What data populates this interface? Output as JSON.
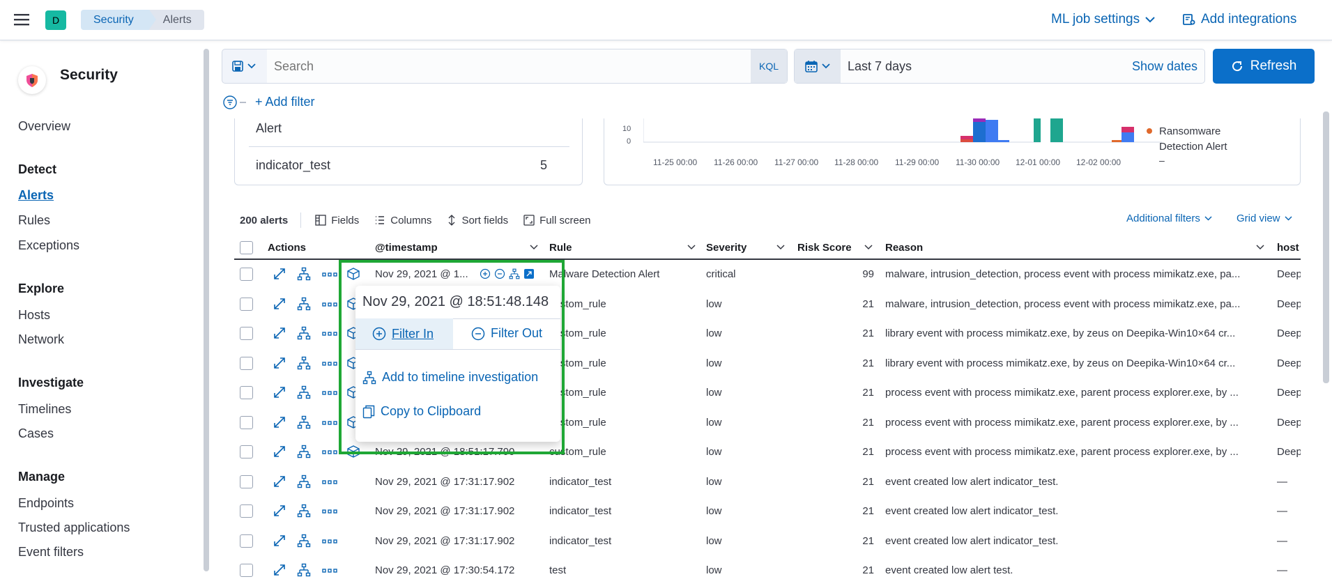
{
  "header": {
    "space_initial": "D",
    "breadcrumbs": [
      "Security",
      "Alerts"
    ],
    "ml_job_settings": "ML job settings",
    "add_integrations": "Add integrations"
  },
  "sidebar": {
    "title": "Security",
    "overview": "Overview",
    "sections": [
      {
        "heading": "Detect",
        "items": [
          "Alerts",
          "Rules",
          "Exceptions"
        ]
      },
      {
        "heading": "Explore",
        "items": [
          "Hosts",
          "Network"
        ]
      },
      {
        "heading": "Investigate",
        "items": [
          "Timelines",
          "Cases"
        ]
      },
      {
        "heading": "Manage",
        "items": [
          "Endpoints",
          "Trusted applications",
          "Event filters"
        ]
      }
    ],
    "active_item": "Alerts"
  },
  "search": {
    "placeholder": "Search",
    "language": "KQL",
    "date_range": "Last 7 days",
    "show_dates": "Show dates",
    "refresh": "Refresh",
    "add_filter": "+ Add filter"
  },
  "summary": {
    "left_rows": [
      {
        "label": "Alert",
        "count": ""
      },
      {
        "label": "indicator_test",
        "count": "5"
      }
    ],
    "histogram": {
      "y_ticks": [
        "10",
        "0"
      ],
      "x_ticks": [
        "11-25 00:00",
        "11-26 00:00",
        "11-27 00:00",
        "11-28 00:00",
        "11-29 00:00",
        "11-30 00:00",
        "12-01 00:00",
        "12-02 00:00"
      ],
      "legend_item": "Ransomware Detection Alert",
      "legend_more": "–"
    }
  },
  "toolbar": {
    "count": "200 alerts",
    "fields": "Fields",
    "columns": "Columns",
    "sort_fields": "Sort fields",
    "full_screen": "Full screen",
    "additional_filters": "Additional filters",
    "grid_view": "Grid view"
  },
  "table": {
    "headers": {
      "actions": "Actions",
      "timestamp": "@timestamp",
      "rule": "Rule",
      "severity": "Severity",
      "risk_score": "Risk Score",
      "reason": "Reason",
      "host": "host"
    },
    "rows": [
      {
        "timestamp": "Nov 29, 2021 @ 1...",
        "rule": "Malware Detection Alert",
        "severity": "critical",
        "risk": "99",
        "reason": "malware, intrusion_detection, process event with process mimikatz.exe, pa...",
        "host": "Deep"
      },
      {
        "timestamp": "",
        "rule": "custom_rule",
        "severity": "low",
        "risk": "21",
        "reason": "malware, intrusion_detection, process event with process mimikatz.exe, pa...",
        "host": "Deep"
      },
      {
        "timestamp": "",
        "rule": "custom_rule",
        "severity": "low",
        "risk": "21",
        "reason": "library event with process mimikatz.exe, by zeus on Deepika-Win10×64 cr...",
        "host": "Deep"
      },
      {
        "timestamp": "",
        "rule": "custom_rule",
        "severity": "low",
        "risk": "21",
        "reason": "library event with process mimikatz.exe, by zeus on Deepika-Win10×64 cr...",
        "host": "Deep"
      },
      {
        "timestamp": "",
        "rule": "custom_rule",
        "severity": "low",
        "risk": "21",
        "reason": "process event with process mimikatz.exe, parent process explorer.exe, by ...",
        "host": "Deep"
      },
      {
        "timestamp": "",
        "rule": "custom_rule",
        "severity": "low",
        "risk": "21",
        "reason": "process event with process mimikatz.exe, parent process explorer.exe, by ...",
        "host": "Deep"
      },
      {
        "timestamp": "Nov 29, 2021 @ 18:51:17.790",
        "rule": "custom_rule",
        "severity": "low",
        "risk": "21",
        "reason": "process event with process mimikatz.exe, parent process explorer.exe, by ...",
        "host": "Deep"
      },
      {
        "timestamp": "Nov 29, 2021 @ 17:31:17.902",
        "rule": "indicator_test",
        "severity": "low",
        "risk": "21",
        "reason": "event created low alert indicator_test.",
        "host": "—"
      },
      {
        "timestamp": "Nov 29, 2021 @ 17:31:17.902",
        "rule": "indicator_test",
        "severity": "low",
        "risk": "21",
        "reason": "event created low alert indicator_test.",
        "host": "—"
      },
      {
        "timestamp": "Nov 29, 2021 @ 17:31:17.902",
        "rule": "indicator_test",
        "severity": "low",
        "risk": "21",
        "reason": "event created low alert indicator_test.",
        "host": "—"
      },
      {
        "timestamp": "Nov 29, 2021 @ 17:30:54.172",
        "rule": "test",
        "severity": "low",
        "risk": "21",
        "reason": "event created low alert test.",
        "host": "—"
      }
    ]
  },
  "popover": {
    "title": "Nov 29, 2021 @ 18:51:48.148",
    "filter_in": "Filter In",
    "filter_out": "Filter Out",
    "add_timeline": "Add to timeline investigation",
    "copy": "Copy to Clipboard"
  },
  "colors": {
    "accent": "#0a65b4",
    "highlight": "#1fa735",
    "avatar": "#16b9a2"
  }
}
